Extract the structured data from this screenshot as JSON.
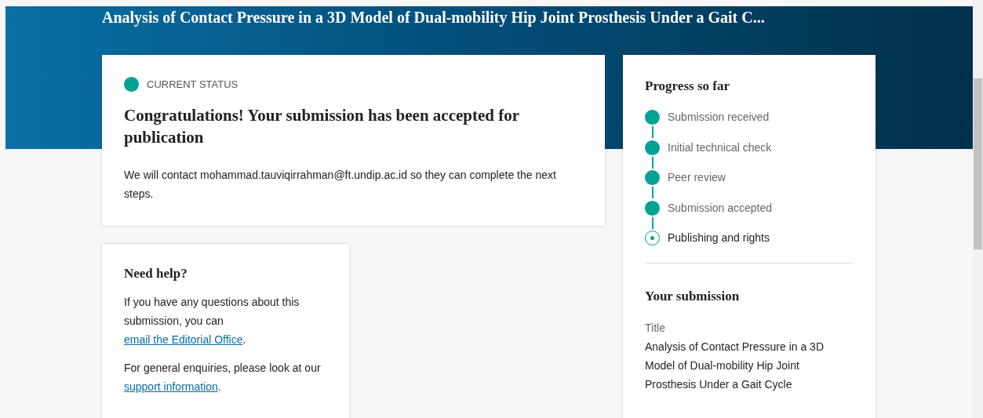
{
  "header": {
    "title": "Analysis of Contact Pressure in a 3D Model of Dual-mobility Hip Joint Prosthesis Under a Gait C..."
  },
  "status_card": {
    "label": "CURRENT STATUS",
    "color": "#00a294",
    "heading": "Congratulations! Your submission has been accepted for publication",
    "message": "We will contact mohammad.tauviqirrahman@ft.undip.ac.id so they can complete the next steps."
  },
  "help_card": {
    "heading": "Need help?",
    "paragraphs": [
      {
        "before": "If you have any questions about this submission, you can ",
        "link": "email the Editorial Office",
        "after": "."
      },
      {
        "before": "For general enquiries, please look at our ",
        "link": "support information",
        "after": "."
      }
    ]
  },
  "progress": {
    "heading": "Progress so far",
    "steps": [
      {
        "label": "Submission received",
        "completed": true
      },
      {
        "label": "Initial technical check",
        "completed": true
      },
      {
        "label": "Peer review",
        "completed": true
      },
      {
        "label": "Submission accepted",
        "completed": true
      },
      {
        "label": "Publishing and rights",
        "completed": false
      }
    ]
  },
  "submission": {
    "heading": "Your submission",
    "title_label": "Title",
    "title": "Analysis of Contact Pressure in a 3D Model of Dual-mobility Hip Joint Prosthesis Under a Gait Cycle"
  }
}
